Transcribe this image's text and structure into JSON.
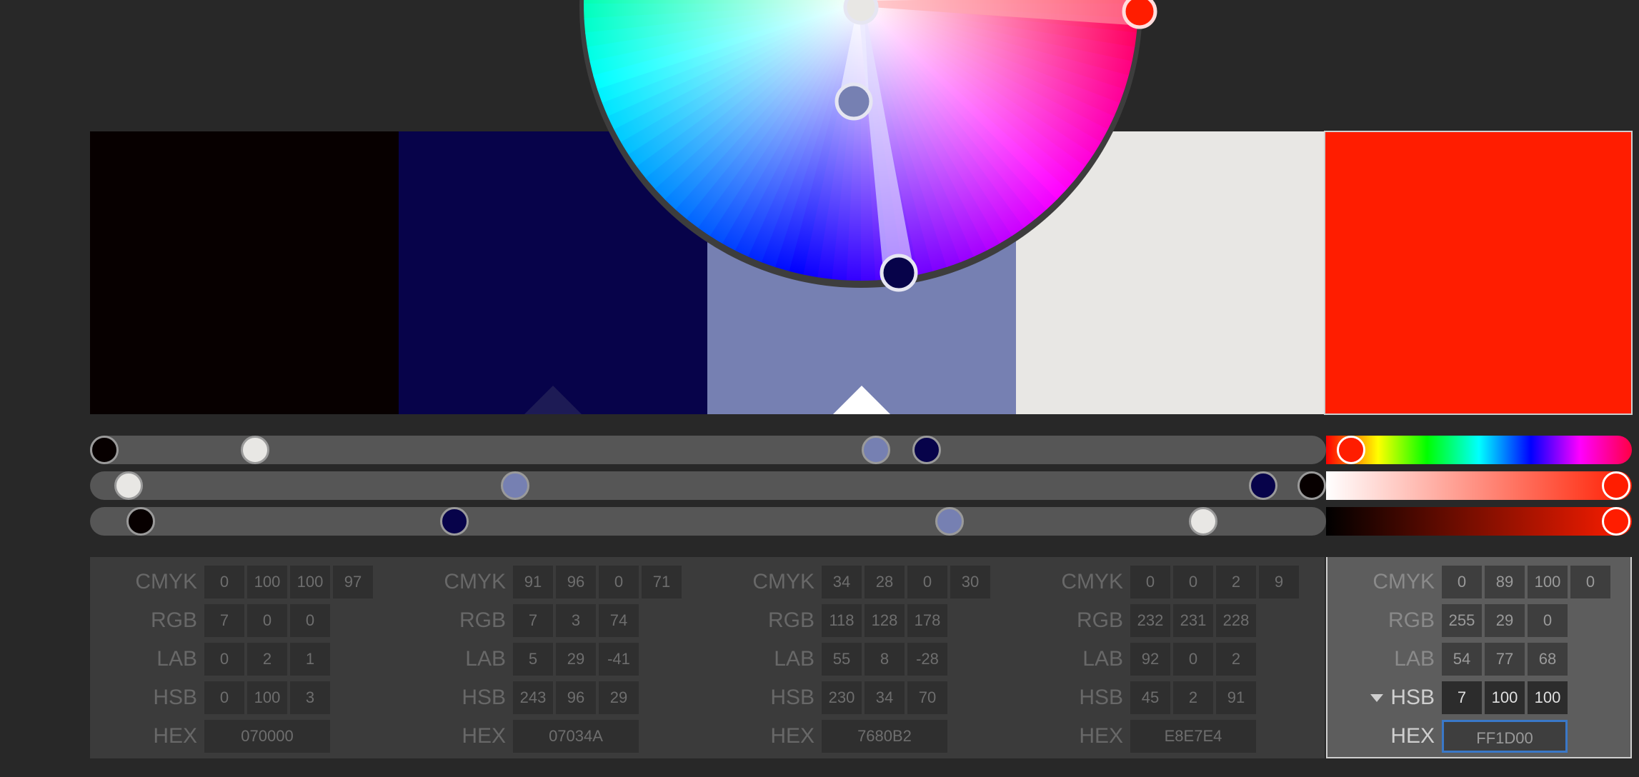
{
  "swatches": [
    {
      "color": "#070000",
      "cmyk": [
        "0",
        "100",
        "100",
        "97"
      ],
      "rgb": [
        "7",
        "0",
        "0"
      ],
      "lab": [
        "0",
        "2",
        "1"
      ],
      "hsb": [
        "0",
        "100",
        "3"
      ],
      "hex": "070000"
    },
    {
      "color": "#07034A",
      "cmyk": [
        "91",
        "96",
        "0",
        "71"
      ],
      "rgb": [
        "7",
        "3",
        "74"
      ],
      "lab": [
        "5",
        "29",
        "-41"
      ],
      "hsb": [
        "243",
        "96",
        "29"
      ],
      "hex": "07034A"
    },
    {
      "color": "#7680B2",
      "cmyk": [
        "34",
        "28",
        "0",
        "30"
      ],
      "rgb": [
        "118",
        "128",
        "178"
      ],
      "lab": [
        "55",
        "8",
        "-28"
      ],
      "hsb": [
        "230",
        "34",
        "70"
      ],
      "hex": "7680B2"
    },
    {
      "color": "#E8E7E4",
      "cmyk": [
        "0",
        "0",
        "2",
        "9"
      ],
      "rgb": [
        "232",
        "231",
        "228"
      ],
      "lab": [
        "92",
        "0",
        "2"
      ],
      "hsb": [
        "45",
        "2",
        "91"
      ],
      "hex": "E8E7E4"
    },
    {
      "color": "#FF1D00",
      "cmyk": [
        "0",
        "89",
        "100",
        "0"
      ],
      "rgb": [
        "255",
        "29",
        "0"
      ],
      "lab": [
        "54",
        "77",
        "68"
      ],
      "hsb": [
        "7",
        "100",
        "100"
      ],
      "hex": "FF1D00"
    }
  ],
  "labels": {
    "cmyk": "CMYK",
    "rgb": "RGB",
    "lab": "LAB",
    "hsb": "HSB",
    "hex": "HEX"
  },
  "selected_swatch": 4,
  "base_swatch": 2,
  "colors": {
    "background": "#282828",
    "panel": "#3b3b3b",
    "selected_panel": "#5d5d5d",
    "focus_border": "#3a78c8"
  },
  "sliders": [
    {
      "name": "hue",
      "values": [
        0,
        0.681,
        0.639,
        0.125
      ]
    },
    {
      "name": "saturation",
      "values": [
        1.0,
        0.96,
        0.34,
        0.02
      ]
    },
    {
      "name": "brightness",
      "values": [
        0.03,
        0.29,
        0.7,
        0.91
      ]
    }
  ],
  "selected_sliders": {
    "hue": 0.019,
    "saturation": 1.0,
    "brightness": 1.0
  },
  "wheel": {
    "handles": [
      "#FF1D00",
      "#E8E7E4",
      "#7680B2",
      "#07034A",
      "#070000"
    ]
  }
}
